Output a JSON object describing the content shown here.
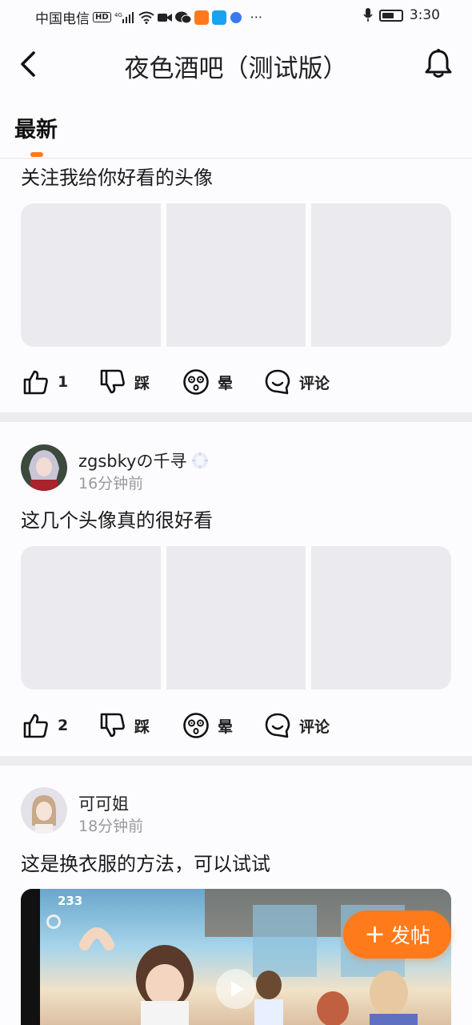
{
  "status_bar": {
    "carrier": "中国电信",
    "network": "4G",
    "time": "3:30"
  },
  "header": {
    "title": "夜色酒吧（测试版）"
  },
  "tabs": [
    {
      "label": "最新",
      "active": true
    }
  ],
  "posts": [
    {
      "text": "关注我给你好看的头像",
      "actions": {
        "like": "1",
        "dislike": "踩",
        "dizzy": "晕",
        "comment": "评论"
      }
    },
    {
      "user": "zgsbkyの千寻",
      "time": "16分钟前",
      "text": "这几个头像真的很好看",
      "actions": {
        "like": "2",
        "dislike": "踩",
        "dizzy": "晕",
        "comment": "评论"
      }
    },
    {
      "user": "可可姐",
      "time": "18分钟前",
      "text": "这是换衣服的方法，可以试试",
      "video_count": "233"
    }
  ],
  "fab": {
    "label": "发帖"
  },
  "colors": {
    "accent": "#ff7a1a",
    "placeholder": "#ebeaee"
  }
}
